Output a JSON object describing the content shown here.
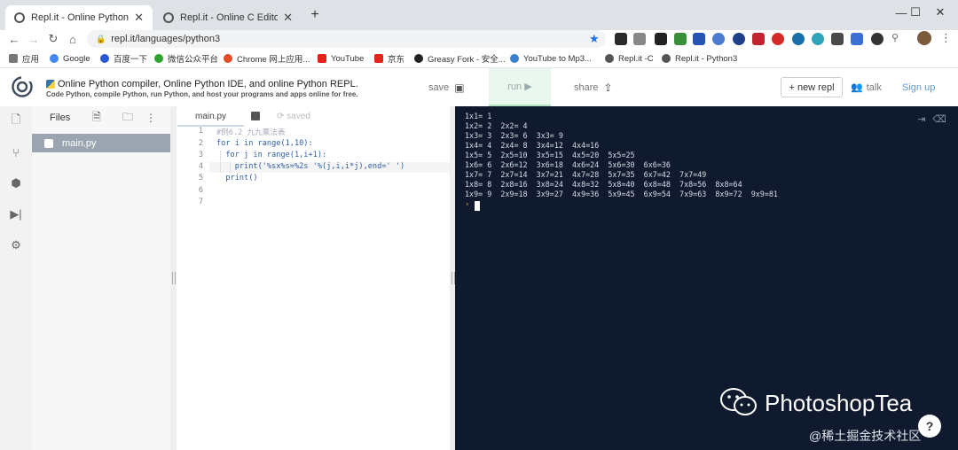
{
  "browser": {
    "tabs": [
      {
        "title": "Repl.it - Online Python Editor",
        "active": true
      },
      {
        "title": "Repl.it - Online C Editor and II",
        "active": false
      }
    ],
    "new_tab_icon": "+",
    "window_controls": {
      "minimize": "—",
      "maximize": "☐",
      "close": "✕"
    },
    "url": "repl.it/languages/python3",
    "bookmarks": [
      "应用",
      "Google",
      "百度一下",
      "微信公众平台",
      "Chrome 网上应用...",
      "YouTube",
      "京东",
      "Greasy Fork - 安全...",
      "YouTube to Mp3...",
      "Repl.it -C",
      "Repl.it - Python3"
    ]
  },
  "header": {
    "tagline": "Online Python compiler, Online Python IDE, and online Python REPL.",
    "subtagline": "Code Python, compile Python, run Python, and host your programs and apps online for free.",
    "save_label": "save",
    "run_label": "run ▶",
    "share_label": "share",
    "new_repl_label": "+ new repl",
    "talk_label": "talk",
    "signup_label": "Sign up"
  },
  "files": {
    "title": "Files",
    "items": [
      {
        "name": "main.py"
      }
    ]
  },
  "editor": {
    "tab_label": "main.py",
    "status": "saved",
    "lines": [
      {
        "n": "1",
        "text": "#例6.2 九九乘法表"
      },
      {
        "n": "2",
        "text": "for i in range(1,10):"
      },
      {
        "n": "3",
        "text": "  for j in range(1,i+1):"
      },
      {
        "n": "4",
        "text": "    print('%sx%s=%2s '%(j,i,i*j),end=' ')"
      },
      {
        "n": "5",
        "text": "  print()"
      },
      {
        "n": "6",
        "text": ""
      },
      {
        "n": "7",
        "text": ""
      }
    ]
  },
  "console": {
    "lines": [
      "1x1= 1",
      "1x2= 2  2x2= 4",
      "1x3= 3  2x3= 6  3x3= 9",
      "1x4= 4  2x4= 8  3x4=12  4x4=16",
      "1x5= 5  2x5=10  3x5=15  4x5=20  5x5=25",
      "1x6= 6  2x6=12  3x6=18  4x6=24  5x6=30  6x6=36",
      "1x7= 7  2x7=14  3x7=21  4x7=28  5x7=35  6x7=42  7x7=49",
      "1x8= 8  2x8=16  3x8=24  4x8=32  5x8=40  6x8=48  7x8=56  8x8=64",
      "1x9= 9  2x9=18  3x9=27  4x9=36  5x9=45  6x9=54  7x9=63  8x9=72  9x9=81"
    ],
    "prompt": "›"
  },
  "watermark": {
    "brand": "PhotoshopTea",
    "sub": "@稀土掘金技术社区"
  },
  "help_label": "?"
}
